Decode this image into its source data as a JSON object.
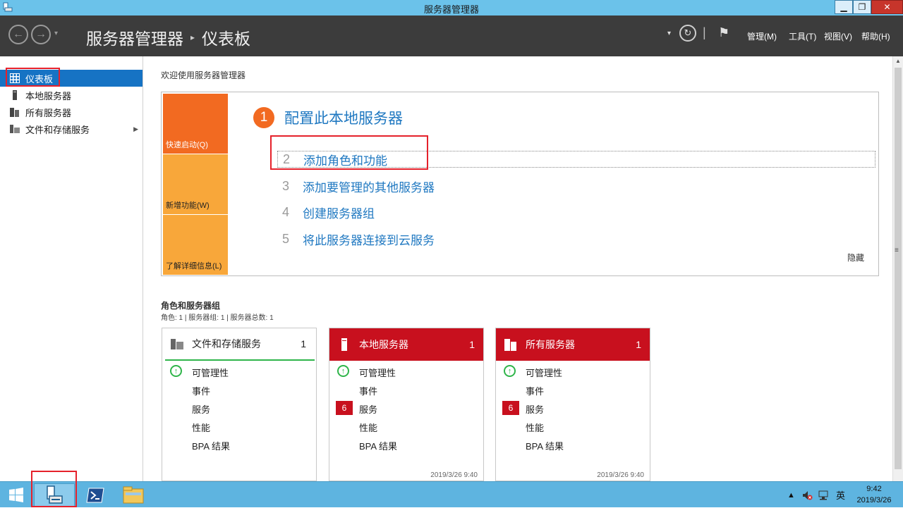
{
  "window": {
    "title": "服务器管理器",
    "min": "▁",
    "max": "❐",
    "close": "✕"
  },
  "header": {
    "breadcrumb_root": "服务器管理器",
    "breadcrumb_sep": "▸",
    "breadcrumb_page": "仪表板",
    "menus": [
      "管理(M)",
      "工具(T)",
      "视图(V)",
      "帮助(H)"
    ]
  },
  "sidebar": {
    "items": [
      {
        "label": "仪表板",
        "icon": "dashboard-icon",
        "active": true
      },
      {
        "label": "本地服务器",
        "icon": "server-icon"
      },
      {
        "label": "所有服务器",
        "icon": "servers-icon"
      },
      {
        "label": "文件和存储服务",
        "icon": "storage-icon"
      }
    ]
  },
  "main": {
    "welcome": "欢迎使用服务器管理器",
    "tiles": [
      "快速启动(Q)",
      "新增功能(W)",
      "了解详细信息(L)"
    ],
    "steps": [
      {
        "num": "1",
        "label": "配置此本地服务器"
      },
      {
        "num": "2",
        "label": "添加角色和功能"
      },
      {
        "num": "3",
        "label": "添加要管理的其他服务器"
      },
      {
        "num": "4",
        "label": "创建服务器组"
      },
      {
        "num": "5",
        "label": "将此服务器连接到云服务"
      }
    ],
    "hide": "隐藏",
    "roles_title": "角色和服务器组",
    "roles_subtitle": "角色: 1 | 服务器组: 1 | 服务器总数: 1",
    "cards": [
      {
        "name": "文件和存储服务",
        "count": "1",
        "manageability": "可管理性",
        "events": "事件",
        "services": "服务",
        "performance": "性能",
        "bpa": "BPA 结果"
      },
      {
        "name": "本地服务器",
        "count": "1",
        "manageability": "可管理性",
        "events": "事件",
        "services": "服务",
        "services_badge": "6",
        "performance": "性能",
        "bpa": "BPA 结果",
        "time": "2019/3/26 9:40"
      },
      {
        "name": "所有服务器",
        "count": "1",
        "manageability": "可管理性",
        "events": "事件",
        "services": "服务",
        "services_badge": "6",
        "performance": "性能",
        "bpa": "BPA 结果",
        "time": "2019/3/26 9:40"
      }
    ]
  },
  "taskbar": {
    "tray_arrow": "▲",
    "ime": "英",
    "time": "9:42",
    "date": "2019/3/26"
  },
  "colors": {
    "accent": "#1673c4",
    "orange": "#f26a21",
    "red": "#c8101e",
    "green": "#2fb54a",
    "taskbar": "#5eb4e0"
  }
}
